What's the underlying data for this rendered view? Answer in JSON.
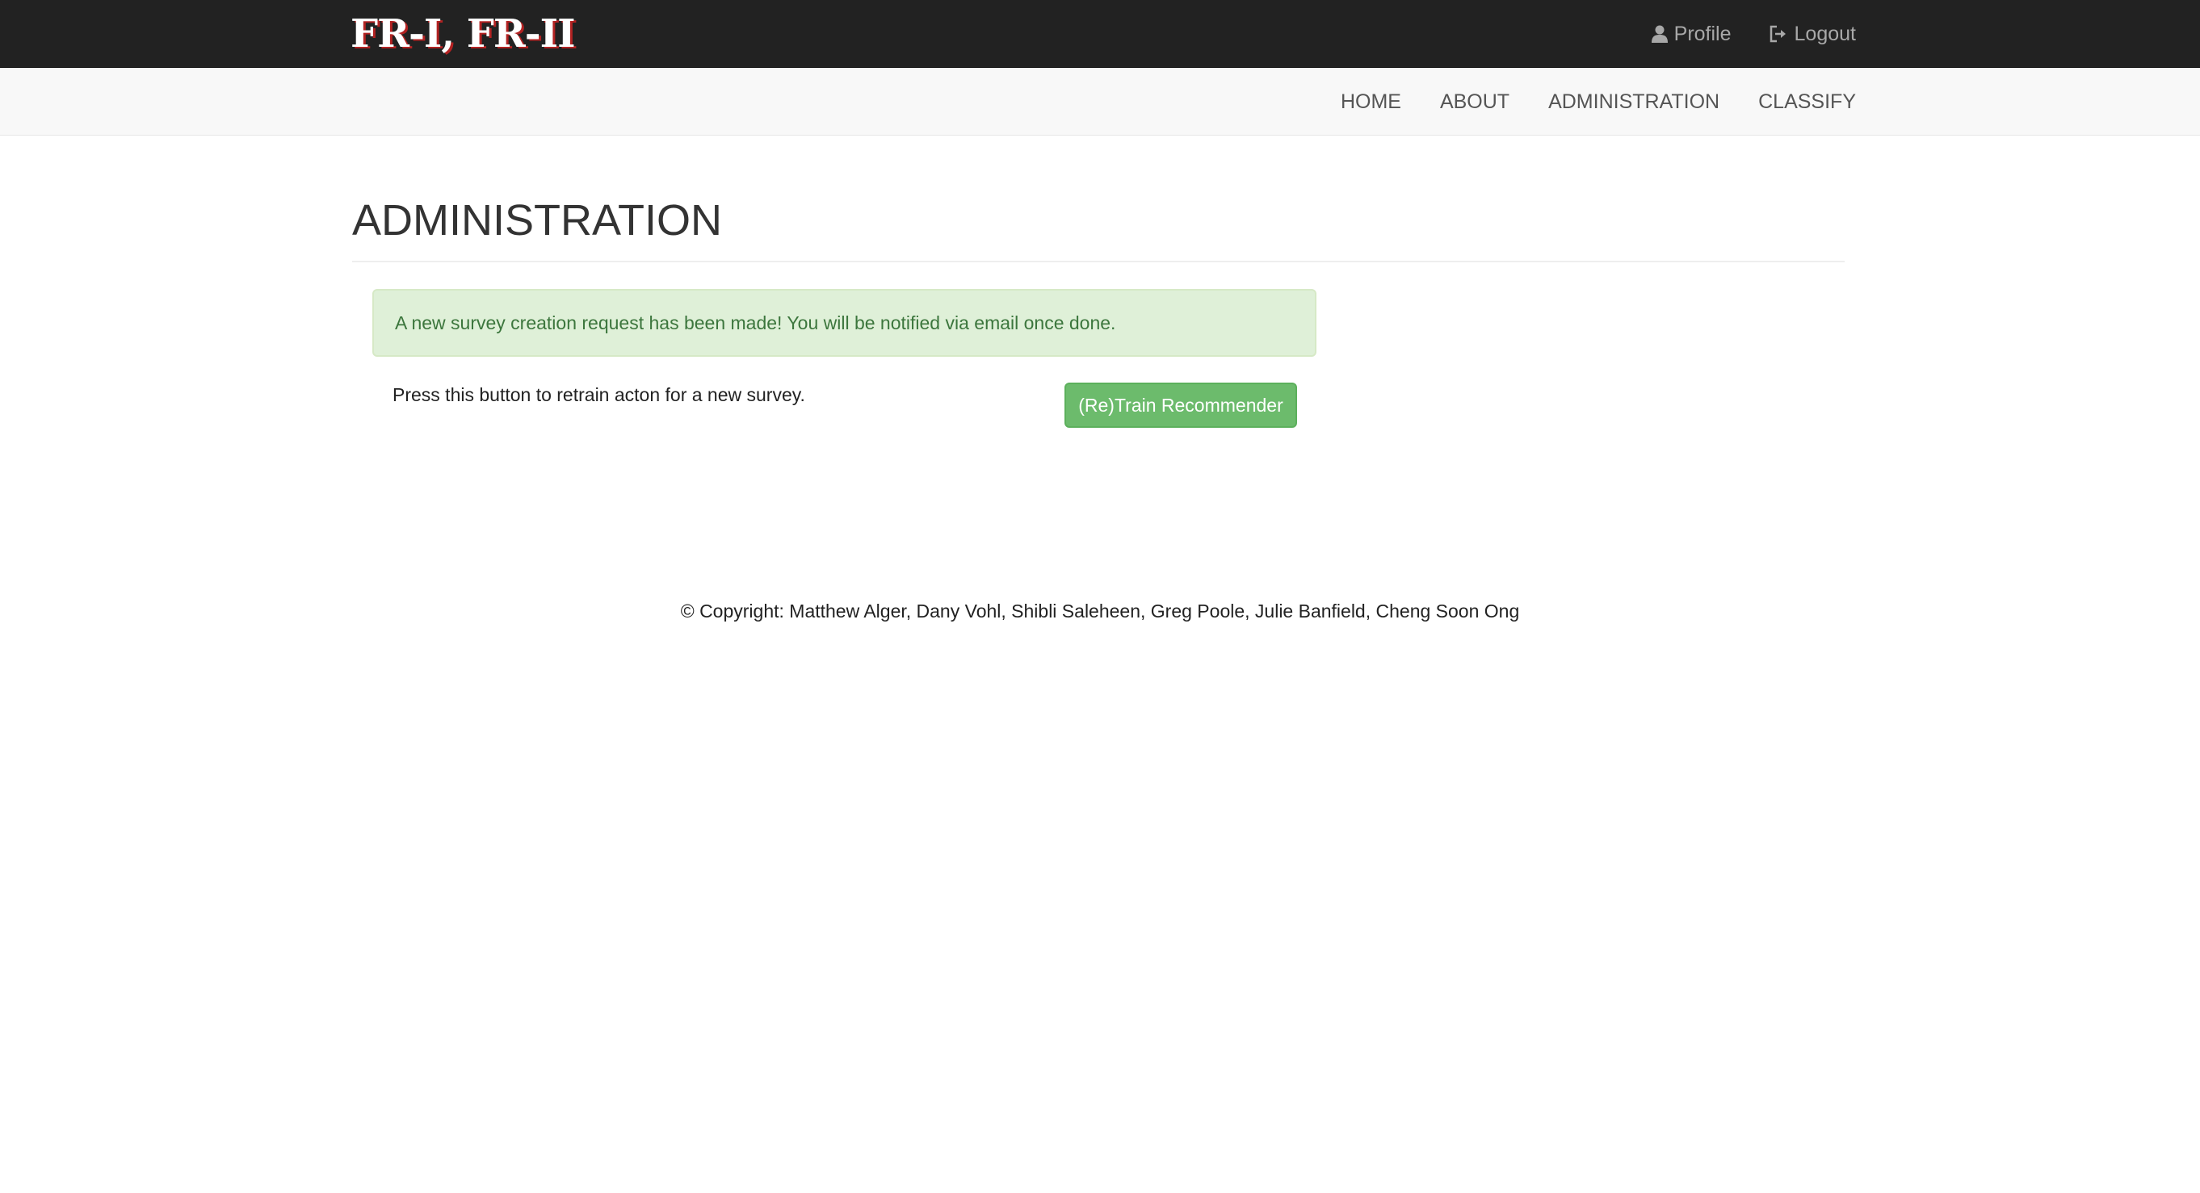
{
  "header": {
    "brand": "FR-I, FR-II",
    "profile_label": "Profile",
    "logout_label": "Logout"
  },
  "nav": {
    "items": [
      {
        "label": "HOME"
      },
      {
        "label": "ABOUT"
      },
      {
        "label": "ADMINISTRATION"
      },
      {
        "label": "CLASSIFY"
      }
    ]
  },
  "main": {
    "title": "ADMINISTRATION",
    "alert_text": "A new survey creation request has been made! You will be notified via email once done.",
    "retrain_text": "Press this button to retrain acton for a new survey.",
    "retrain_button_label": "(Re)Train Recommender"
  },
  "footer": {
    "copyright": "© Copyright: Matthew Alger, Dany Vohl, Shibli Saleheen, Greg Poole, Julie Banfield, Cheng Soon Ong"
  },
  "colors": {
    "topbar_bg": "#222222",
    "navbar_bg": "#f8f8f8",
    "alert_bg": "#dff0d8",
    "alert_text": "#3c763d",
    "button_bg": "#6cbb6c"
  },
  "icons": {
    "profile": "user-icon",
    "logout": "logout-icon"
  }
}
